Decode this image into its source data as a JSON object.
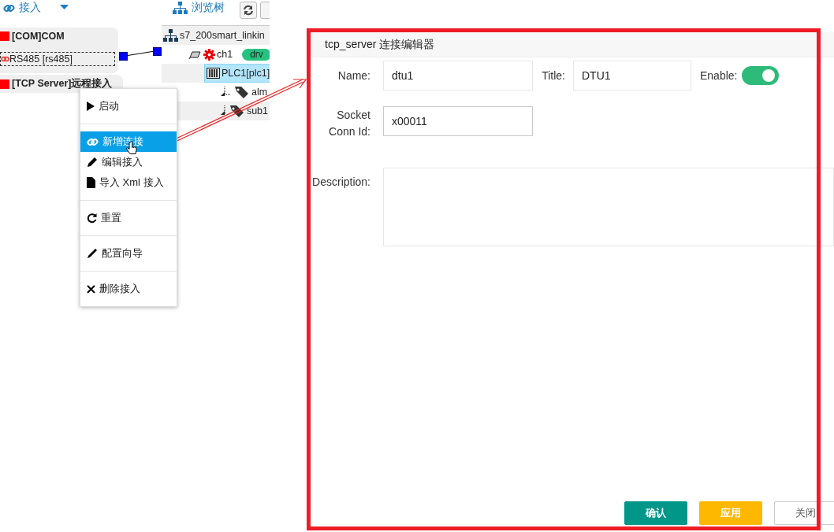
{
  "toolbar": {
    "connect_label": "接入",
    "browse_label": "浏览树"
  },
  "connectors": [
    {
      "title": "[COM]COM",
      "port": "RS485 [rs485]"
    },
    {
      "title": "[TCP Server]远程接入"
    }
  ],
  "tree": {
    "label": "s7_200smart_linkin",
    "kind": "root",
    "selected": false,
    "children": [
      {
        "label": "ch1",
        "kind": "channel",
        "badge": "drv",
        "selected": false,
        "children": [
          {
            "label": "PLC1[plc1]",
            "kind": "device",
            "selected": true,
            "children": [
              {
                "label": "alm",
                "kind": "tag",
                "selected": false
              },
              {
                "label": "sub1",
                "kind": "tag",
                "selected": false
              }
            ]
          }
        ]
      }
    ]
  },
  "context_menu": {
    "groups": [
      {
        "items": [
          {
            "label": "启动",
            "kind": "start",
            "selected": false
          }
        ]
      },
      {
        "items": [
          {
            "label": "新增连接",
            "kind": "link",
            "selected": true
          },
          {
            "label": "编辑接入",
            "kind": "edit",
            "selected": false
          },
          {
            "label": "导入 Xml 接入",
            "kind": "file",
            "selected": false
          }
        ]
      },
      {
        "items": [
          {
            "label": "重置",
            "kind": "reset",
            "selected": false
          }
        ]
      },
      {
        "items": [
          {
            "label": "配置向导",
            "kind": "wizard",
            "selected": false
          }
        ]
      },
      {
        "items": [
          {
            "label": "删除接入",
            "kind": "delete",
            "selected": false
          }
        ]
      }
    ]
  },
  "dialog": {
    "title": "tcp_server 连接编辑器",
    "name": {
      "label": "Name:",
      "value": "dtu1"
    },
    "title_field": {
      "label": "Title:",
      "value": "DTU1"
    },
    "enable": {
      "label": "Enable:",
      "on": true
    },
    "socket_conn_id": {
      "label": "Socket Conn Id:",
      "value": "x00011",
      "focused": true
    },
    "description": {
      "label": "Description:"
    },
    "buttons": [
      {
        "label": "确认",
        "kind": "primary"
      },
      {
        "label": "应用",
        "kind": "warning"
      },
      {
        "label": "关闭",
        "kind": "plain"
      }
    ]
  }
}
